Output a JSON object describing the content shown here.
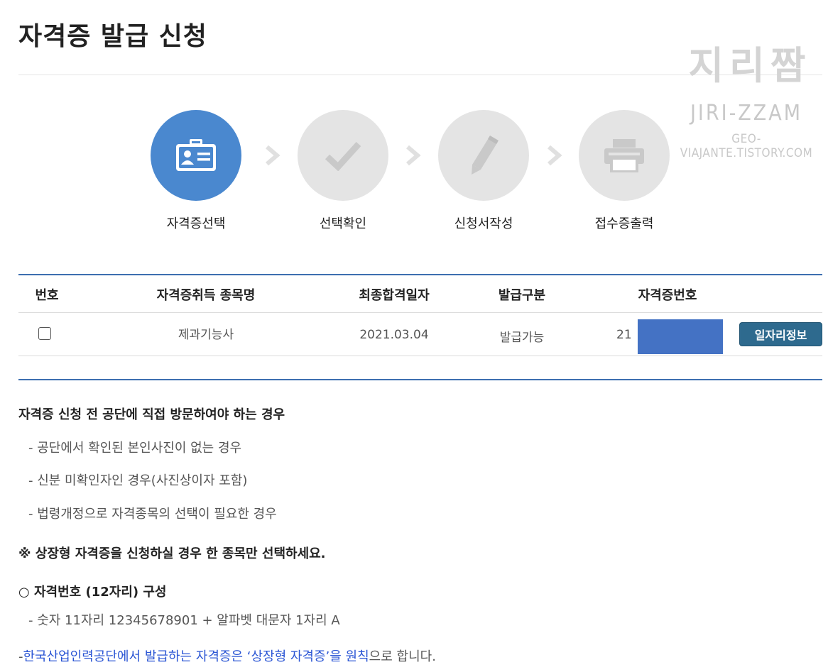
{
  "page": {
    "title": "자격증 발급 신청"
  },
  "watermark": {
    "logo": "지리짬",
    "name": "JIRI-ZZAM",
    "url": "GEO-VIAJANTE.TISTORY.COM"
  },
  "steps": [
    {
      "label": "자격증선택",
      "icon": "id-card-icon",
      "active": true
    },
    {
      "label": "선택확인",
      "icon": "checkmark-icon",
      "active": false
    },
    {
      "label": "신청서작성",
      "icon": "pencil-icon",
      "active": false
    },
    {
      "label": "접수증출력",
      "icon": "printer-icon",
      "active": false
    }
  ],
  "table": {
    "headers": [
      "번호",
      "자격증취득 종목명",
      "최종합격일자",
      "발급구분",
      "자격증번호"
    ],
    "rows": [
      {
        "name": "제과기능사",
        "date": "2021.03.04",
        "status": "발급가능",
        "number_prefix": "21",
        "button": "일자리정보"
      }
    ]
  },
  "notes": {
    "visit_title": "자격증 신청 전 공단에 직접 방문하여야 하는 경우",
    "visit_items": [
      "- 공단에서 확인된 본인사진이 없는 경우",
      "- 신분 미확인자인 경우(사진상이자 포함)",
      "- 법령개정으로 자격종목의 선택이 필요한 경우"
    ],
    "award_notice": "※ 상장형 자격증을 신청하실 경우 한 종목만 선택하세요.",
    "number_title": "○ 자격번호 (12자리) 구성",
    "number_desc": "- 숫자 11자리 12345678901 + 알파벳 대문자 1자리 A",
    "footer": {
      "dash": "-",
      "part1": "한국산업인력공단에서 발급하는 자격증은 ‘상장형 자격증’을 원칙",
      "part2": "으로 합니다."
    }
  },
  "colors": {
    "accent": "#4a88cf",
    "rule": "#3d6fb0",
    "button": "#2e6a8e",
    "mask": "#4472c4",
    "link": "#2a55d4"
  }
}
